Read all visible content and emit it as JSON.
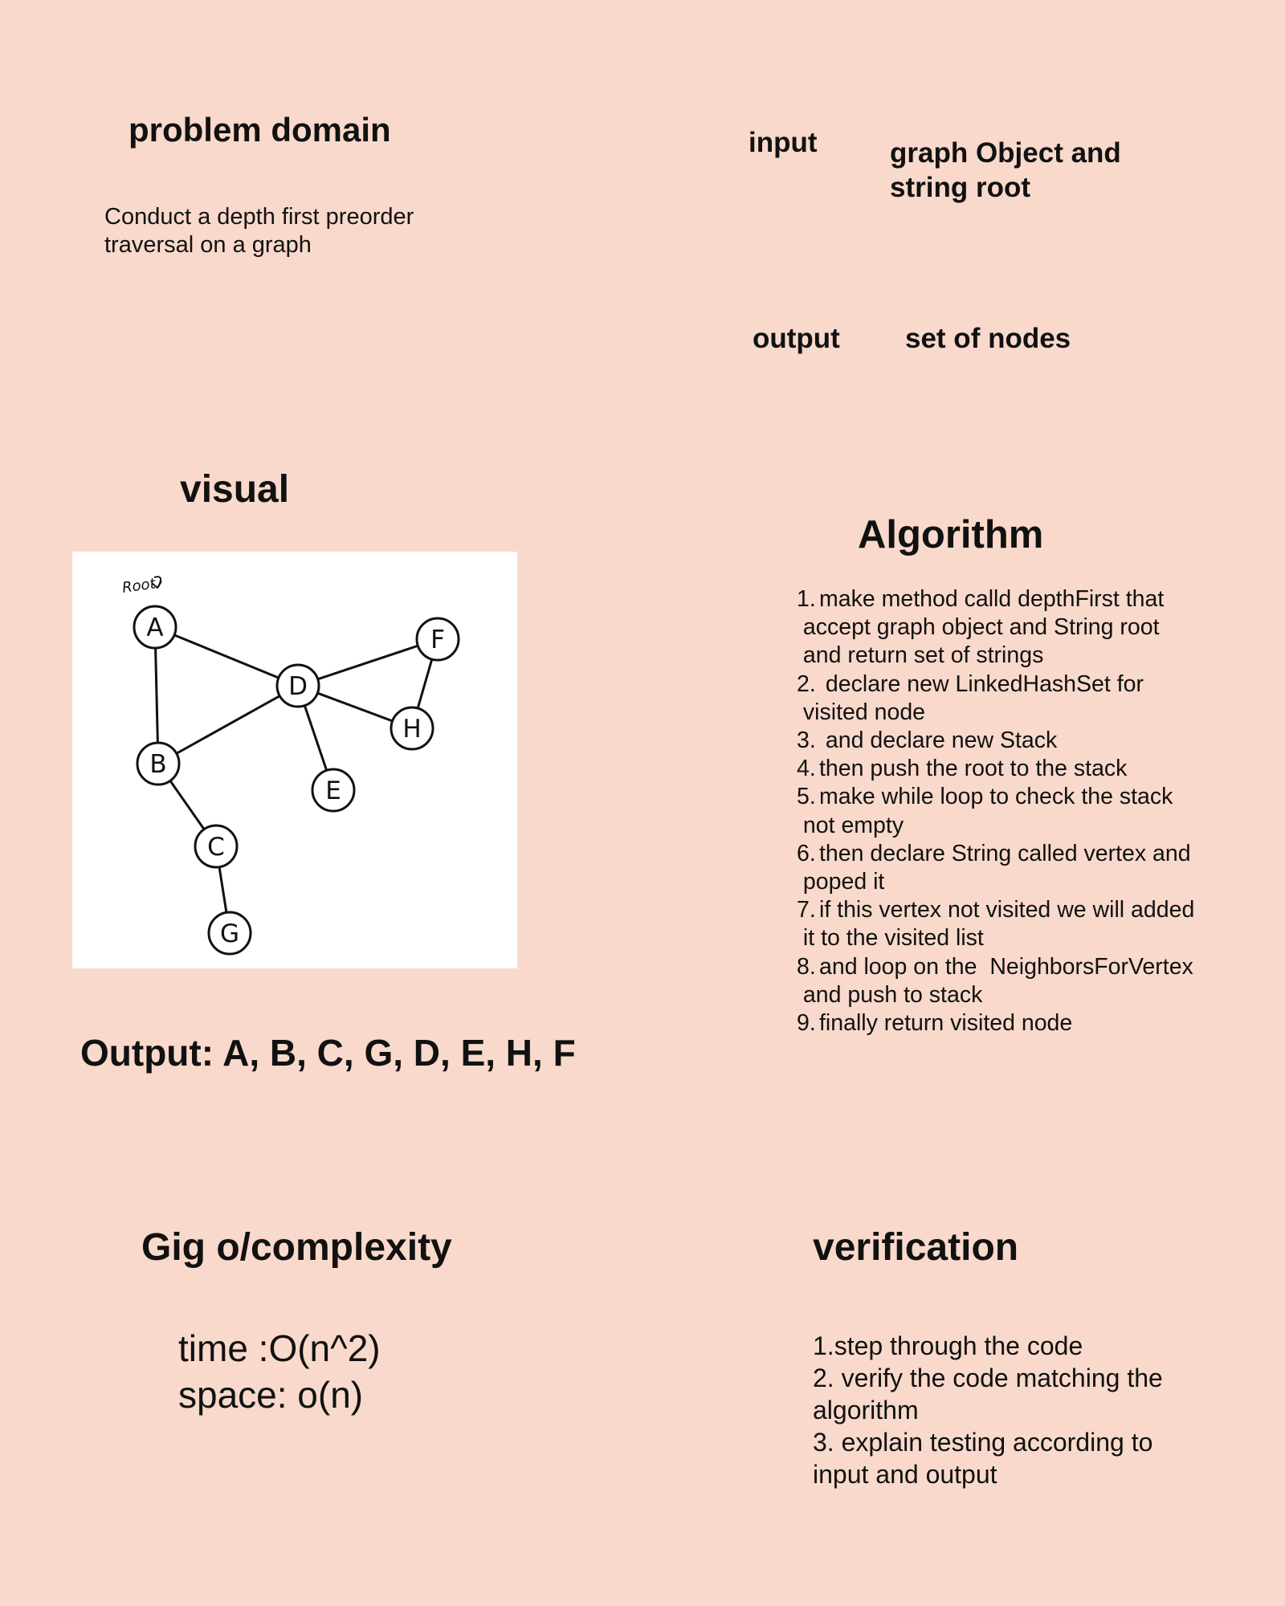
{
  "colors": {
    "background": "#F8D9CB",
    "text": "#111111",
    "graph_panel": "#FFFFFF",
    "graph_stroke": "#111111"
  },
  "problem": {
    "heading": "problem domain",
    "description": "Conduct a depth first preorder traversal on a graph"
  },
  "io": {
    "input_label": "input",
    "input_value": "graph Object and string root",
    "output_label": "output",
    "output_value": "set of nodes"
  },
  "visual": {
    "heading": "visual",
    "root_annotation": "Root",
    "output_text": "Output: A, B, C, G, D, E, H, F",
    "graph": {
      "nodes": [
        "A",
        "B",
        "C",
        "D",
        "E",
        "F",
        "G",
        "H"
      ],
      "edges": [
        [
          "A",
          "B"
        ],
        [
          "A",
          "D"
        ],
        [
          "B",
          "D"
        ],
        [
          "B",
          "C"
        ],
        [
          "C",
          "G"
        ],
        [
          "D",
          "F"
        ],
        [
          "D",
          "H"
        ],
        [
          "D",
          "E"
        ],
        [
          "F",
          "H"
        ]
      ]
    }
  },
  "algorithm": {
    "heading": "Algorithm",
    "steps": [
      {
        "num": "1.",
        "text": "make method calld depthFirst that\n accept graph object and String root\n and return set of strings"
      },
      {
        "num": "2.",
        "text": " declare new LinkedHashSet for\n visited node"
      },
      {
        "num": "3.",
        "text": " and declare new Stack"
      },
      {
        "num": "4.",
        "text": "then push the root to the stack"
      },
      {
        "num": "5.",
        "text": "make while loop to check the stack\n not empty"
      },
      {
        "num": "6.",
        "text": "then declare String called vertex and\n poped it"
      },
      {
        "num": "7.",
        "text": "if this vertex not visited we will added\n it to the visited list"
      },
      {
        "num": "8.",
        "text": "and loop on the  NeighborsForVertex\n and push to stack"
      },
      {
        "num": "9.",
        "text": "finally return visited node"
      }
    ]
  },
  "complexity": {
    "heading": "Gig o/complexity",
    "time": "time :O(n^2)",
    "space": "space: o(n)"
  },
  "verification": {
    "heading": "verification",
    "items": [
      "1.step through the code",
      "2. verify the code matching the algorithm",
      "3. explain  testing  according to input and output"
    ]
  }
}
